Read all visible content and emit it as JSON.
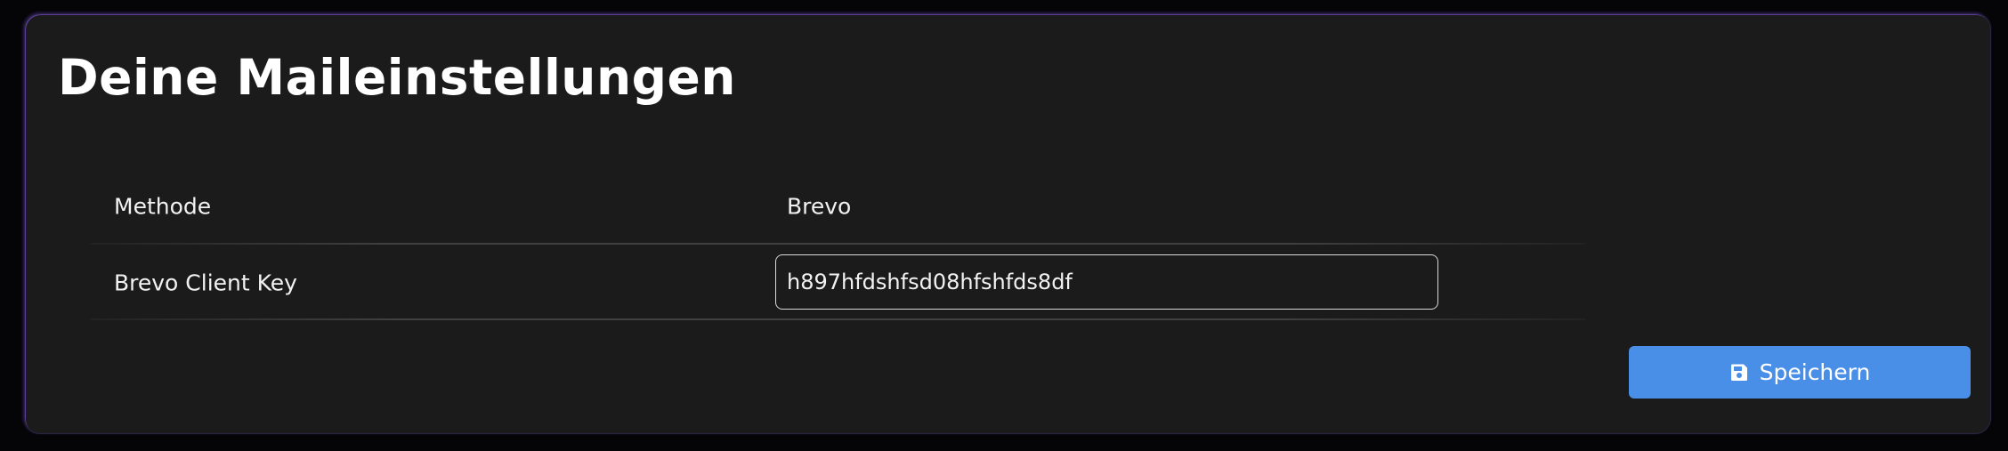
{
  "page": {
    "title": "Deine Maileinstellungen"
  },
  "settings": {
    "method_label": "Methode",
    "method_value": "Brevo",
    "client_key_label": "Brevo Client Key",
    "client_key_value": "h897hfdshfsd08hfshfds8df"
  },
  "actions": {
    "save_label": "Speichern",
    "save_icon": "floppy-disk-icon"
  },
  "colors": {
    "background": "#050507",
    "card": "#1b1b1c",
    "accent_border": "#7c4dff",
    "button": "#4a8fe7",
    "text": "#ffffff"
  }
}
